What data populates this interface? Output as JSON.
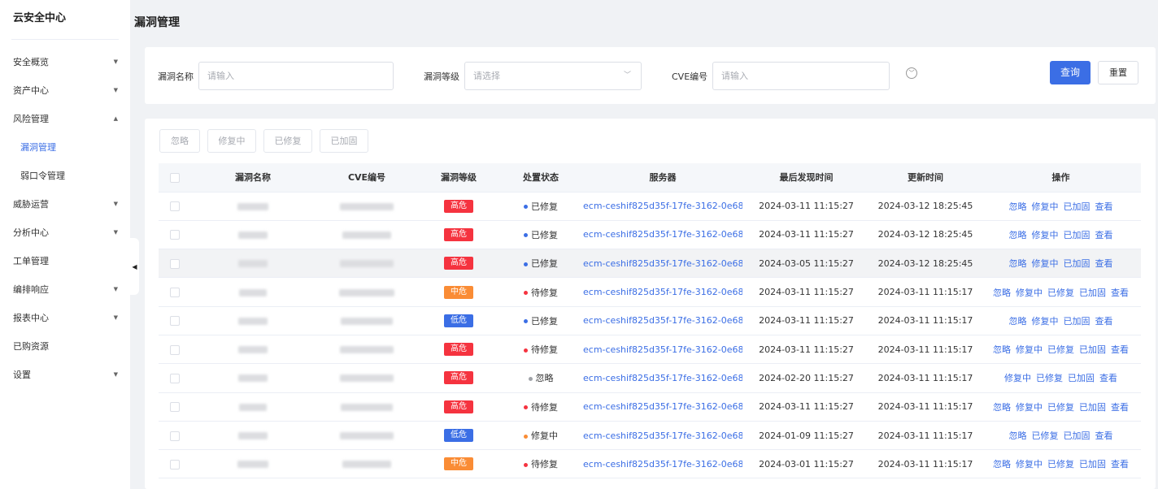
{
  "sidebar": {
    "brand": "云安全中心",
    "items": [
      {
        "label": "安全概览",
        "chevron": "down"
      },
      {
        "label": "资产中心",
        "chevron": "down"
      },
      {
        "label": "风险管理",
        "chevron": "up"
      },
      {
        "label": "漏洞管理",
        "sub": true,
        "active": true
      },
      {
        "label": "弱口令管理",
        "sub": true
      },
      {
        "label": "威胁运营",
        "chevron": "down"
      },
      {
        "label": "分析中心",
        "chevron": "down"
      },
      {
        "label": "工单管理"
      },
      {
        "label": "编排响应",
        "chevron": "down"
      },
      {
        "label": "报表中心",
        "chevron": "down"
      },
      {
        "label": "已购资源"
      },
      {
        "label": "设置",
        "chevron": "down"
      }
    ]
  },
  "page": {
    "title": "漏洞管理"
  },
  "filters": {
    "name_label": "漏洞名称",
    "name_placeholder": "请输入",
    "level_label": "漏洞等级",
    "level_placeholder": "请选择",
    "cve_label": "CVE编号",
    "cve_placeholder": "请输入",
    "expand_icon": "circle-chevron-down-icon",
    "query_label": "查询",
    "reset_label": "重置"
  },
  "batch_actions": [
    "忽略",
    "修复中",
    "已修复",
    "已加固"
  ],
  "colors": {
    "accent": "#3b6ee5",
    "high": "#f5333f",
    "medium": "#fa8c35",
    "low": "#3b6ee5",
    "status_fixed": "#3b6ee5",
    "status_pending": "#f5333f",
    "status_ignored": "#a0a3a8",
    "status_fixing": "#fa8c35"
  },
  "table": {
    "columns": [
      "漏洞名称",
      "CVE编号",
      "漏洞等级",
      "处置状态",
      "服务器",
      "最后发现时间",
      "更新时间",
      "操作"
    ],
    "rows": [
      {
        "level": "高危",
        "level_key": "high",
        "status": "已修复",
        "status_key": "fixed",
        "server": "ecm-ceshif825d35f-17fe-3162-0e68-...",
        "found": "2024-03-11 11:15:27",
        "updated": "2024-03-12 18:25:45",
        "ops": [
          "忽略",
          "修复中",
          "已加固",
          "查看"
        ]
      },
      {
        "level": "高危",
        "level_key": "high",
        "status": "已修复",
        "status_key": "fixed",
        "server": "ecm-ceshif825d35f-17fe-3162-0e68-...",
        "found": "2024-03-11 11:15:27",
        "updated": "2024-03-12 18:25:45",
        "ops": [
          "忽略",
          "修复中",
          "已加固",
          "查看"
        ]
      },
      {
        "level": "高危",
        "level_key": "high",
        "status": "已修复",
        "status_key": "fixed",
        "server": "ecm-ceshif825d35f-17fe-3162-0e68-...",
        "found": "2024-03-05 11:15:27",
        "updated": "2024-03-12 18:25:45",
        "ops": [
          "忽略",
          "修复中",
          "已加固",
          "查看"
        ],
        "highlight": true
      },
      {
        "level": "中危",
        "level_key": "medium",
        "status": "待修复",
        "status_key": "pending",
        "server": "ecm-ceshif825d35f-17fe-3162-0e68-...",
        "found": "2024-03-11 11:15:27",
        "updated": "2024-03-11 11:15:17",
        "ops": [
          "忽略",
          "修复中",
          "已修复",
          "已加固",
          "查看"
        ]
      },
      {
        "level": "低危",
        "level_key": "low",
        "status": "已修复",
        "status_key": "fixed",
        "server": "ecm-ceshif825d35f-17fe-3162-0e68-...",
        "found": "2024-03-11 11:15:27",
        "updated": "2024-03-11 11:15:17",
        "ops": [
          "忽略",
          "修复中",
          "已加固",
          "查看"
        ]
      },
      {
        "level": "高危",
        "level_key": "high",
        "status": "待修复",
        "status_key": "pending",
        "server": "ecm-ceshif825d35f-17fe-3162-0e68-...",
        "found": "2024-03-11 11:15:27",
        "updated": "2024-03-11 11:15:17",
        "ops": [
          "忽略",
          "修复中",
          "已修复",
          "已加固",
          "查看"
        ]
      },
      {
        "level": "高危",
        "level_key": "high",
        "status": "忽略",
        "status_key": "ignored",
        "server": "ecm-ceshif825d35f-17fe-3162-0e68-...",
        "found": "2024-02-20 11:15:27",
        "updated": "2024-03-11 11:15:17",
        "ops": [
          "修复中",
          "已修复",
          "已加固",
          "查看"
        ]
      },
      {
        "level": "高危",
        "level_key": "high",
        "status": "待修复",
        "status_key": "pending",
        "server": "ecm-ceshif825d35f-17fe-3162-0e68-...",
        "found": "2024-03-11 11:15:27",
        "updated": "2024-03-11 11:15:17",
        "ops": [
          "忽略",
          "修复中",
          "已修复",
          "已加固",
          "查看"
        ]
      },
      {
        "level": "低危",
        "level_key": "low",
        "status": "修复中",
        "status_key": "fixing",
        "server": "ecm-ceshif825d35f-17fe-3162-0e68-...",
        "found": "2024-01-09 11:15:27",
        "updated": "2024-03-11 11:15:17",
        "ops": [
          "忽略",
          "已修复",
          "已加固",
          "查看"
        ]
      },
      {
        "level": "中危",
        "level_key": "medium",
        "status": "待修复",
        "status_key": "pending",
        "server": "ecm-ceshif825d35f-17fe-3162-0e68-...",
        "found": "2024-03-01 11:15:27",
        "updated": "2024-03-11 11:15:17",
        "ops": [
          "忽略",
          "修复中",
          "已修复",
          "已加固",
          "查看"
        ]
      }
    ]
  }
}
